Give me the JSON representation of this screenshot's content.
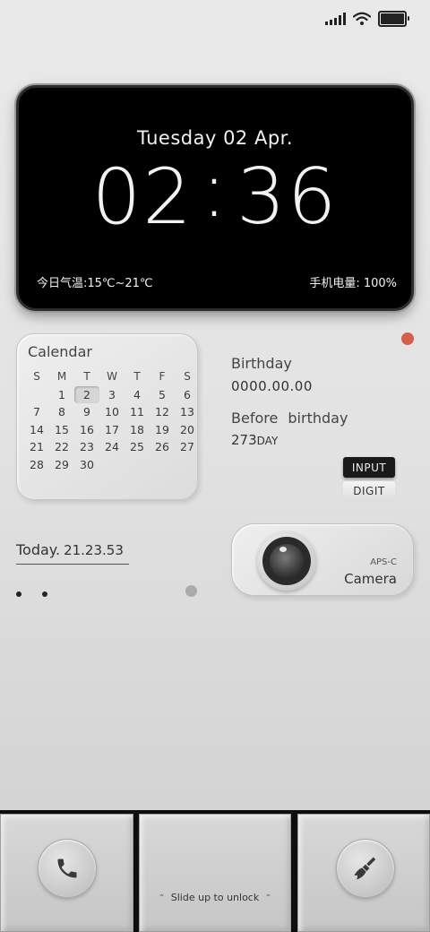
{
  "status_bar": {
    "icons": [
      "signal-icon",
      "wifi-icon",
      "battery-icon"
    ]
  },
  "clock": {
    "date": "Tuesday 02 Apr.",
    "hour": "02",
    "minute": "36",
    "separator": ":",
    "weather": "今日气温:15℃~21℃",
    "battery": "手机电量:  100%"
  },
  "calendar": {
    "title": "Calendar",
    "weekdays": [
      "S",
      "M",
      "T",
      "W",
      "T",
      "F",
      "S"
    ],
    "highlighted_day": "2",
    "rows": [
      [
        "",
        "1",
        "2",
        "3",
        "4",
        "5",
        "6"
      ],
      [
        "7",
        "8",
        "9",
        "10",
        "11",
        "12",
        "13"
      ],
      [
        "14",
        "15",
        "16",
        "17",
        "18",
        "19",
        "20"
      ],
      [
        "21",
        "22",
        "23",
        "24",
        "25",
        "26",
        "27"
      ],
      [
        "28",
        "29",
        "30",
        "",
        "",
        "",
        ""
      ]
    ]
  },
  "birthday": {
    "label": "Birthday",
    "date": "0000.00.00",
    "before_label": "Before birthday",
    "days": "273",
    "days_unit": "DAY"
  },
  "buttons": {
    "input": "INPUT",
    "digit": "DIGIT"
  },
  "today": {
    "label": "Today.",
    "time": "21.23.53"
  },
  "camera": {
    "format": "APS-C",
    "label": "Camera"
  },
  "dock": {
    "unlock_text": "Slide up to unlock",
    "left_icon": "phone-icon",
    "right_icon": "broom-icon"
  },
  "colors": {
    "accent_dot": "#d5604a",
    "clock_bg": "#000000"
  }
}
